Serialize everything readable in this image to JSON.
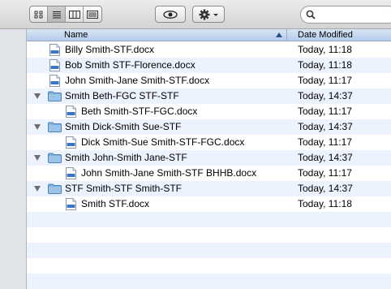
{
  "toolbar": {
    "view_buttons": [
      "icon-view",
      "list-view",
      "column-view",
      "coverflow-view"
    ],
    "active_view": "list-view",
    "search_placeholder": ""
  },
  "header": {
    "name_label": "Name",
    "date_label": "Date Modified"
  },
  "colors": {
    "selected_header": "#b4ccec",
    "row_stripe": "#edf3fe",
    "folder": "#6fa6d8"
  },
  "rows": [
    {
      "type": "file",
      "level": 0,
      "name": "Billy Smith-STF.docx",
      "date": "Today, 11:18"
    },
    {
      "type": "file",
      "level": 0,
      "name": "Bob Smith STF-Florence.docx",
      "date": "Today, 11:18"
    },
    {
      "type": "file",
      "level": 0,
      "name": "John Smith-Jane Smith-STF.docx",
      "date": "Today, 11:17"
    },
    {
      "type": "folder",
      "level": 0,
      "name": "Smith Beth-FGC STF-STF",
      "date": "Today, 14:37"
    },
    {
      "type": "file",
      "level": 1,
      "name": "Beth Smith-STF-FGC.docx",
      "date": "Today, 11:17"
    },
    {
      "type": "folder",
      "level": 0,
      "name": "Smith Dick-Smith Sue-STF",
      "date": "Today, 14:37"
    },
    {
      "type": "file",
      "level": 1,
      "name": "Dick Smith-Sue Smith-STF-FGC.docx",
      "date": "Today, 11:17"
    },
    {
      "type": "folder",
      "level": 0,
      "name": "Smith John-Smith Jane-STF",
      "date": "Today, 14:37"
    },
    {
      "type": "file",
      "level": 1,
      "name": "John Smith-Jane Smith-STF BHHB.docx",
      "date": "Today, 11:17"
    },
    {
      "type": "folder",
      "level": 0,
      "name": "STF Smith-STF Smith-STF",
      "date": "Today, 14:37"
    },
    {
      "type": "file",
      "level": 1,
      "name": "Smith STF.docx",
      "date": "Today, 11:18"
    }
  ]
}
